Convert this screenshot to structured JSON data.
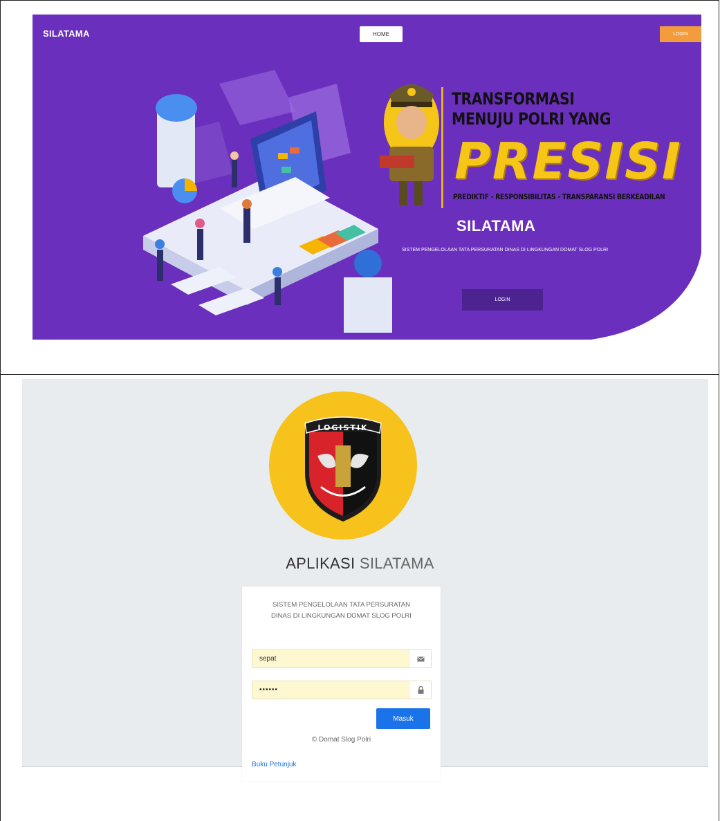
{
  "hero": {
    "brand": "SILATAMA",
    "nav_home": "HOME",
    "nav_login": "LOGIN",
    "tagline_line1": "TRANSFORMASI",
    "tagline_line2": "MENUJU POLRI YANG",
    "presisi": "PRESISI",
    "presisi_sub": "PREDIKTIF - RESPONSIBILITAS - TRANSPARANSI BERKEADILAN",
    "title": "SILATAMA",
    "description": "SISTEM PENGELOLAAN TATA PERSURATAN DINAS DI LINGKUNGAN DOMAT SLOG POLRI",
    "login_button": "LOGIN",
    "colors": {
      "background": "#6b2fbd",
      "accent": "#f39c3d",
      "gold": "#f5c518"
    }
  },
  "login": {
    "logo_text": "LOGISTIK",
    "title_bold": "APLIKASI",
    "title_thin": "SILATAMA",
    "description": "SISTEM PENGELOLAAN TATA PERSURATAN DINAS DI LINGKUNGAN DOMAT SLOG POLRI",
    "username_value": "sepat",
    "username_icon": "envelope-icon",
    "password_value": "••••••",
    "password_icon": "lock-icon",
    "submit_label": "Masuk",
    "copyright": "© Domat Slog Polri",
    "manual_link": "Buku Petunjuk",
    "colors": {
      "background": "#e9ecef",
      "button": "#1a73e8",
      "field_bg": "#fdf8d0",
      "logo_circle": "#f7c21b"
    }
  }
}
